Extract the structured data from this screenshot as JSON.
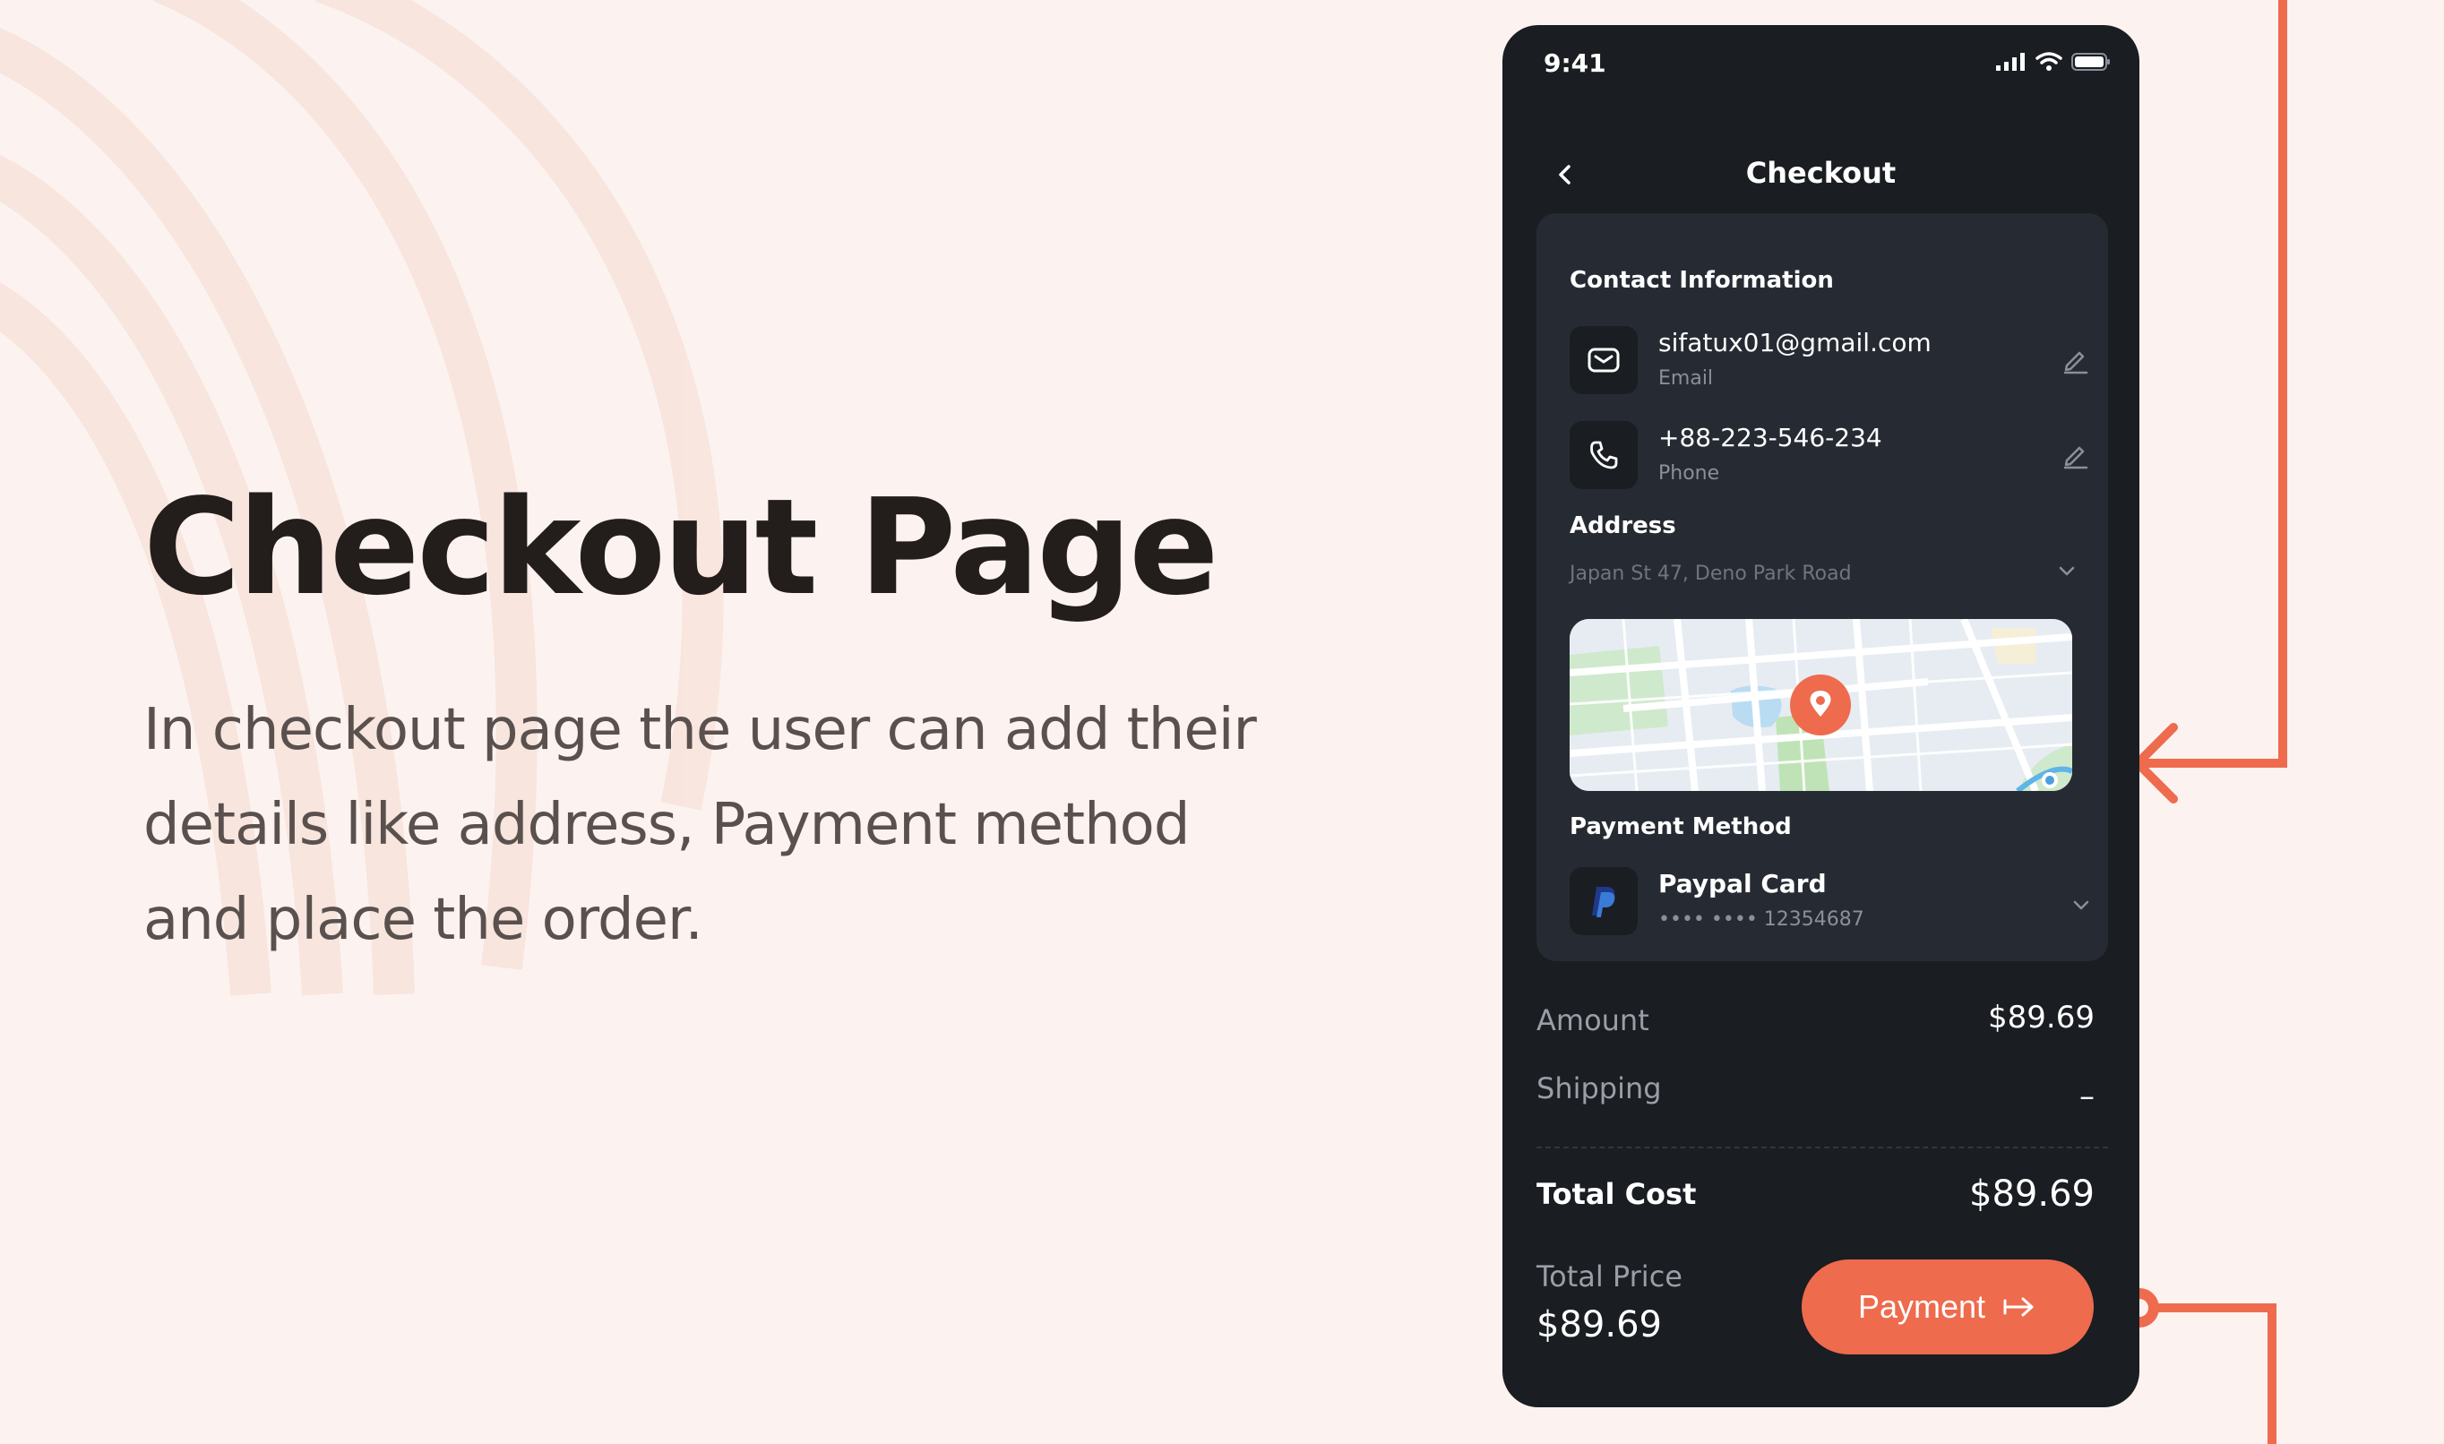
{
  "hero": {
    "title": "Checkout Page",
    "description": "In checkout page the user can add their details like address, Payment method and place the order."
  },
  "status_bar": {
    "time": "9:41"
  },
  "header": {
    "title": "Checkout"
  },
  "contact": {
    "section_title": "Contact Information",
    "email": {
      "value": "sifatux01@gmail.com",
      "label": "Email"
    },
    "phone": {
      "value": "+88-223-546-234",
      "label": "Phone"
    }
  },
  "address": {
    "section_title": "Address",
    "selected": "Japan St 47, Deno Park Road"
  },
  "payment_method": {
    "section_title": "Payment Method",
    "name": "Paypal Card",
    "number": "•••• •••• 12354687"
  },
  "summary": {
    "amount_label": "Amount",
    "amount_value": "$89.69",
    "shipping_label": "Shipping",
    "shipping_value": "–",
    "total_cost_label": "Total Cost",
    "total_cost_value": "$89.69"
  },
  "footer": {
    "total_price_label": "Total Price",
    "total_price_value": "$89.69",
    "payment_button": "Payment"
  },
  "colors": {
    "accent": "#ee6b4d",
    "background": "#fcf3f0",
    "phone": "#1a1d22",
    "card": "#262b33"
  },
  "icons": [
    "back-icon",
    "mail-icon",
    "phone-icon",
    "edit-icon",
    "chevron-down-icon",
    "paypal-icon",
    "map-pin-icon",
    "arrow-right-icon",
    "signal-icon",
    "wifi-icon",
    "battery-icon"
  ]
}
